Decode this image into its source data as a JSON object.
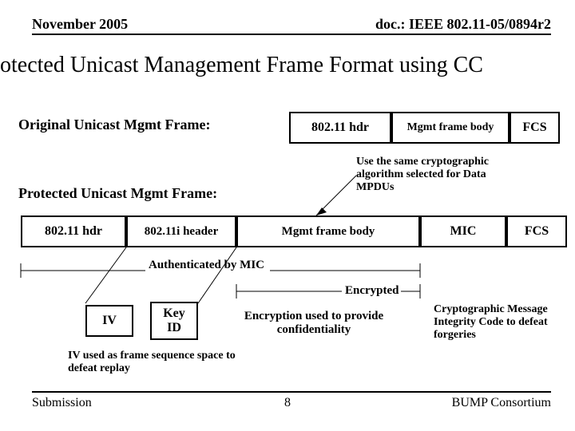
{
  "header": {
    "left": "November 2005",
    "right": "doc.: IEEE 802.11-05/0894r2"
  },
  "title": "otected Unicast Management Frame Format using CC",
  "labels": {
    "original": "Original Unicast Mgmt Frame:",
    "protected": "Protected Unicast Mgmt Frame:"
  },
  "original_frame": {
    "hdr": "802.11 hdr",
    "body": "Mgmt frame body",
    "fcs": "FCS"
  },
  "protected_frame": {
    "hdr": "802.11 hdr",
    "ihdr": "802.11i header",
    "body": "Mgmt frame body",
    "mic": "MIC",
    "fcs": "FCS"
  },
  "keybox": {
    "iv": "IV",
    "keyid": "Key\nID"
  },
  "anno": {
    "algo": "Use the same cryptographic algorithm selected for Data MPDUs",
    "auth": "Authenticated by MIC",
    "enc": "Encrypted",
    "encuse": "Encryption used to provide confidentiality",
    "cmic": "Cryptographic Message Integrity Code to defeat forgeries",
    "iv": "IV used as frame sequence space to defeat replay"
  },
  "footer": {
    "left": "Submission",
    "center": "8",
    "right": "BUMP Consortium"
  }
}
